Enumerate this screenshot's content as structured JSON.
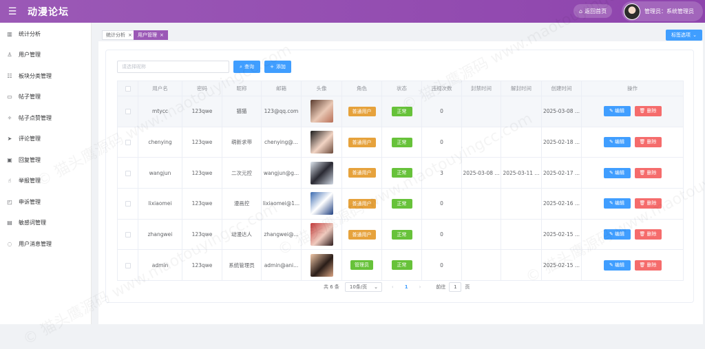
{
  "app": {
    "title": "动漫论坛"
  },
  "header": {
    "home_label": "返回首页",
    "user_label": "管理员：系统管理员"
  },
  "sidebar": {
    "items": [
      {
        "label": "统计分析",
        "icon": "bar-chart-icon"
      },
      {
        "label": "用户管理",
        "icon": "user-icon"
      },
      {
        "label": "板块分类管理",
        "icon": "sliders-icon"
      },
      {
        "label": "帖子管理",
        "icon": "monitor-icon"
      },
      {
        "label": "帖子点赞管理",
        "icon": "sparkle-icon"
      },
      {
        "label": "评论管理",
        "icon": "send-icon"
      },
      {
        "label": "回复管理",
        "icon": "book-icon"
      },
      {
        "label": "举报管理",
        "icon": "thumb-icon"
      },
      {
        "label": "申诉管理",
        "icon": "document-icon"
      },
      {
        "label": "敏感词管理",
        "icon": "lock-icon"
      },
      {
        "label": "用户消息管理",
        "icon": "chat-icon"
      }
    ]
  },
  "tabs": [
    {
      "label": "统计分析",
      "active": false
    },
    {
      "label": "用户管理",
      "active": true
    }
  ],
  "tab_options_label": "标签选项",
  "search": {
    "placeholder": "请选择昵称",
    "query_label": "查询",
    "add_label": "添加"
  },
  "table": {
    "headers": [
      "用户名",
      "密码",
      "昵称",
      "邮箱",
      "头像",
      "角色",
      "状态",
      "违规次数",
      "封禁时间",
      "解封时间",
      "创建时间",
      "操作"
    ],
    "rows": [
      {
        "username": "mtycc",
        "password": "123qwe",
        "nickname": "猫猫",
        "email": "123@qq.com",
        "role": "普通用户",
        "status": "正常",
        "violations": "0",
        "ban_time": "",
        "unban_time": "",
        "created": "2025-03-08 ..."
      },
      {
        "username": "chenying",
        "password": "123qwe",
        "nickname": "萌新求带",
        "email": "chenying@...",
        "role": "普通用户",
        "status": "正常",
        "violations": "0",
        "ban_time": "",
        "unban_time": "",
        "created": "2025-02-18 ..."
      },
      {
        "username": "wangjun",
        "password": "123qwe",
        "nickname": "二次元控",
        "email": "wangjun@g...",
        "role": "普通用户",
        "status": "正常",
        "violations": "3",
        "ban_time": "2025-03-08 ...",
        "unban_time": "2025-03-11 ...",
        "created": "2025-02-17 ..."
      },
      {
        "username": "lixiaomei",
        "password": "123qwe",
        "nickname": "漫画控",
        "email": "lixiaomei@1...",
        "role": "普通用户",
        "status": "正常",
        "violations": "0",
        "ban_time": "",
        "unban_time": "",
        "created": "2025-02-16 ..."
      },
      {
        "username": "zhangwei",
        "password": "123qwe",
        "nickname": "动漫达人",
        "email": "zhangwei@...",
        "role": "普通用户",
        "status": "正常",
        "violations": "0",
        "ban_time": "",
        "unban_time": "",
        "created": "2025-02-15 ..."
      },
      {
        "username": "admin",
        "password": "123qwe",
        "nickname": "系统管理员",
        "email": "admin@ani...",
        "role": "管理员",
        "status": "正常",
        "violations": "0",
        "ban_time": "",
        "unban_time": "",
        "created": "2025-02-15 ..."
      }
    ],
    "edit_label": "编辑",
    "delete_label": "删除"
  },
  "pagination": {
    "total_label": "共 6 条",
    "page_size": "10条/页",
    "current_page": "1",
    "goto_prefix": "前往",
    "goto_value": "1",
    "goto_suffix": "页"
  },
  "watermark": "© 猫头鹰源码 www.maotouyingcc.com",
  "colors": {
    "header": "#9b59b6",
    "primary": "#409eff",
    "success": "#67c23a",
    "warning": "#e6a23c",
    "danger": "#f56c6c"
  }
}
